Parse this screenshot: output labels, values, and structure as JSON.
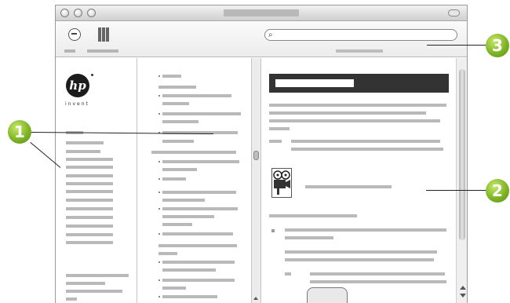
{
  "callouts": {
    "left_navigation": "1",
    "content_area": "2",
    "toolbar_area": "3"
  },
  "logo": {
    "mark": "hp",
    "wordmark": "invent"
  },
  "toolbar": {
    "search_glyph": "⌕"
  },
  "icons": [
    "back-arrow-icon",
    "library-icon",
    "search-icon",
    "camera-icon",
    "printer-icon"
  ],
  "colors": {
    "callout_green": "#7fb426",
    "content_header": "#333333",
    "placeholder_text": "#b9b9b9"
  }
}
